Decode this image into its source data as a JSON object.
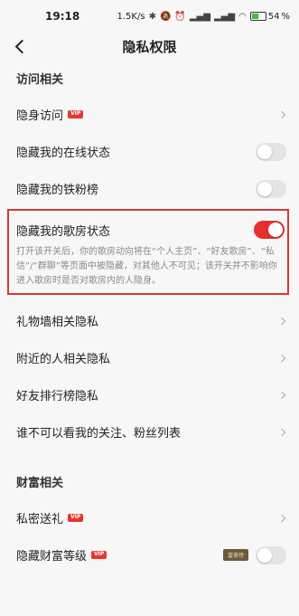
{
  "status": {
    "time": "19:18",
    "speed": "1.5K/s",
    "battery": "54"
  },
  "nav": {
    "title": "隐私权限"
  },
  "sections": {
    "access": "访问相关",
    "wealth": "财富相关"
  },
  "rows": {
    "stealth": "隐身访问",
    "hide_online": "隐藏我的在线状态",
    "hide_fans": "隐藏我的铁粉榜",
    "hide_room": "隐藏我的歌房状态",
    "hide_room_desc": "打开该开关后，你的歌房动向将在“个人主页”、“好友歌房”、“私信”/“群聊”等页面中被隐藏，对其他人不可见；该开关并不影响你进入歌房时是否对歌房内的人隐身。",
    "gift_wall": "礼物墙相关隐私",
    "nearby": "附近的人相关隐私",
    "friend_rank": "好友排行榜隐私",
    "who_cannot_see": "谁不可以看我的关注、粉丝列表",
    "private_gift": "私密送礼",
    "hide_wealth": "隐藏财富等级"
  },
  "vip_label": "VIP",
  "wealth_badge": "富豪榜",
  "toggles": {
    "hide_online": false,
    "hide_fans": false,
    "hide_room": true,
    "hide_wealth": false
  },
  "colors": {
    "accent": "#e4302c",
    "vip": "#e8372f"
  }
}
